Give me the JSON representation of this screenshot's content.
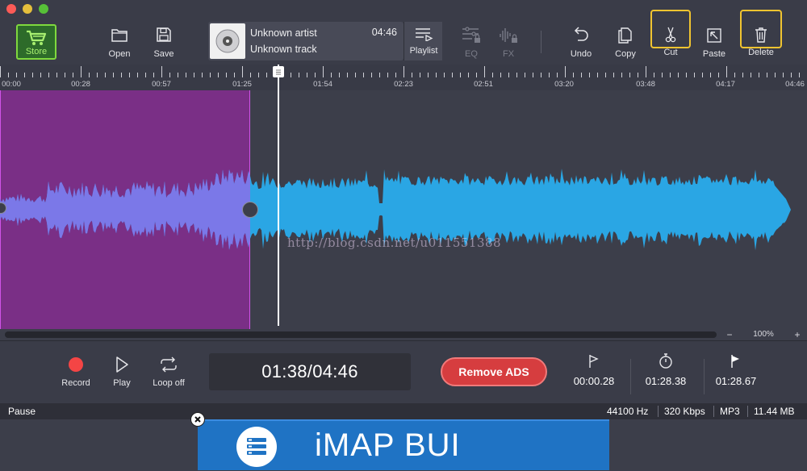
{
  "toolbar": {
    "store_label": "Store",
    "open_label": "Open",
    "save_label": "Save",
    "playlist_label": "Playlist",
    "eq_label": "EQ",
    "fx_label": "FX",
    "undo_label": "Undo",
    "copy_label": "Copy",
    "cut_label": "Cut",
    "paste_label": "Paste",
    "delete_label": "Delete",
    "colors": {
      "store": "#7fd93e",
      "highlight": "#f0c430"
    }
  },
  "track": {
    "artist": "Unknown artist",
    "title": "Unknown track",
    "duration": "04:46"
  },
  "timeline": {
    "ticks": [
      "00:00",
      "00:28",
      "00:57",
      "01:25",
      "01:54",
      "02:23",
      "02:51",
      "03:20",
      "03:48",
      "04:17",
      "04:46"
    ]
  },
  "watermark": "http://blog.csdn.net/u011551388",
  "zoom": {
    "minus": "−",
    "value": "100%",
    "plus": "+"
  },
  "transport": {
    "record_label": "Record",
    "play_label": "Play",
    "loop_label": "Loop off",
    "time": "01:38/04:46",
    "remove_ads_label": "Remove ADS",
    "marker_start": "00:00.28",
    "marker_length": "01:28.38",
    "marker_end": "01:28.67"
  },
  "status": {
    "state": "Pause",
    "sample_rate": "44100 Hz",
    "bitrate": "320 Kbps",
    "format": "MP3",
    "size": "11.44 MB"
  },
  "ad": {
    "text": "iMAP BUI"
  },
  "colors": {
    "waveform": "#2aa6e4",
    "selection": "#7a2f86",
    "record": "#f44545"
  }
}
